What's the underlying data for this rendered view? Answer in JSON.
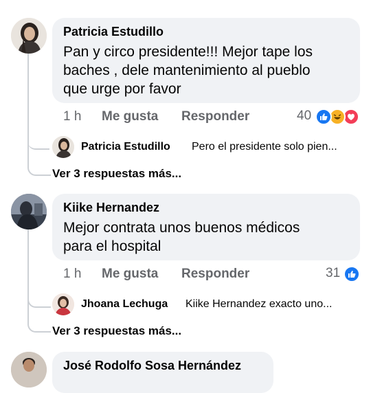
{
  "comments": [
    {
      "author": "Patricia Estudillo",
      "text_lines": [
        "Pan y circo presidente!!! Mejor tape los",
        "baches , dele mantenimiento al pueblo",
        "que urge por favor"
      ],
      "time": "1 h",
      "like_label": "Me gusta",
      "reply_label": "Responder",
      "reaction_count": "40",
      "reactions": [
        "like-icon",
        "haha-icon",
        "love-icon"
      ],
      "reply_preview": {
        "author": "Patricia Estudillo",
        "text": "Pero el presidente solo pien..."
      },
      "more_replies": "Ver 3 respuestas más..."
    },
    {
      "author": "Kiike Hernandez",
      "text_lines": [
        "Mejor contrata unos buenos médicos",
        "para el hospital"
      ],
      "time": "1 h",
      "like_label": "Me gusta",
      "reply_label": "Responder",
      "reaction_count": "31",
      "reactions": [
        "like-icon"
      ],
      "reply_preview": {
        "author": "Jhoana Lechuga",
        "text": "Kiike Hernandez exacto uno..."
      },
      "more_replies": "Ver 3 respuestas más..."
    },
    {
      "author": "José Rodolfo Sosa Hernández"
    }
  ],
  "colors": {
    "like": "#1877f2",
    "love": "#f33e58",
    "haha": "#f7b125",
    "secondary_text": "#65676b",
    "bubble": "#f0f2f5"
  }
}
